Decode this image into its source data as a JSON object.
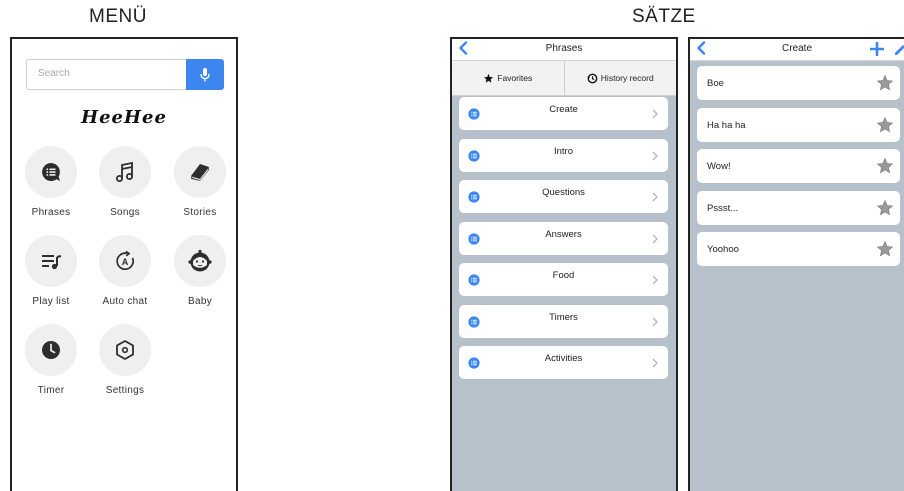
{
  "menu": {
    "caption": "MENÜ",
    "search": {
      "placeholder": "Search",
      "icon": "microphone-icon"
    },
    "logo": "HeeHee",
    "tiles": [
      {
        "label": "Phrases",
        "icon": "chat-bubble-icon"
      },
      {
        "label": "Songs",
        "icon": "music-note-icon"
      },
      {
        "label": "Stories",
        "icon": "book-icon"
      },
      {
        "label": "Play list",
        "icon": "playlist-icon"
      },
      {
        "label": "Auto chat",
        "icon": "auto-chat-icon"
      },
      {
        "label": "Baby",
        "icon": "baby-icon"
      },
      {
        "label": "Timer",
        "icon": "clock-icon"
      },
      {
        "label": "Settings",
        "icon": "settings-hexagon-icon"
      }
    ]
  },
  "phrases": {
    "caption": "SÄTZE",
    "title": "Phrases",
    "tabs": [
      {
        "label": "Favorites",
        "icon": "star-icon"
      },
      {
        "label": "History record",
        "icon": "history-icon"
      }
    ],
    "items": [
      "Create",
      "Intro",
      "Questions",
      "Answers",
      "Food",
      "Timers",
      "Activities"
    ]
  },
  "create": {
    "title": "Create",
    "items": [
      "Boe",
      "Ha ha ha",
      "Wow!",
      "Pssst...",
      "Yoohoo"
    ]
  },
  "colors": {
    "accent": "#3d86f0",
    "list_background": "#b6c1cb",
    "icon_dark": "#2d2d2d"
  }
}
